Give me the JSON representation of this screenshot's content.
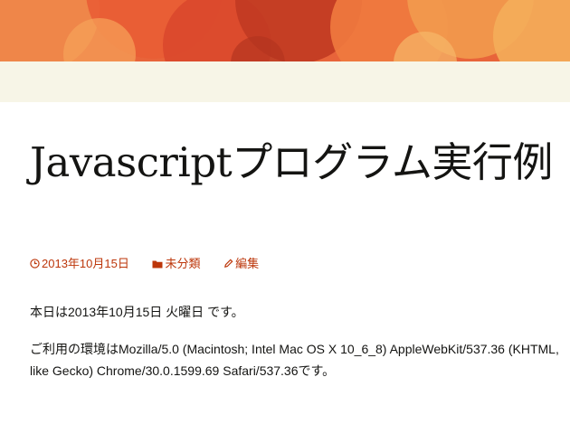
{
  "colors": {
    "banner_base": "#e8643a",
    "nav_background": "#f7f5e7",
    "link_accent": "#bc360a",
    "text": "#141412"
  },
  "post": {
    "title": "Javascriptプログラム実行例",
    "meta": {
      "date": "2013年10月15日",
      "date_icon": "clock-icon",
      "category": "未分類",
      "category_icon": "folder-icon",
      "edit": "編集",
      "edit_icon": "pencil-icon"
    },
    "content": {
      "paragraph_1": "本日は2013年10月15日 火曜日 です。",
      "paragraph_2": "ご利用の環境はMozilla/5.0 (Macintosh; Intel Mac OS X 10_6_8) AppleWebKit/537.36 (KHTML, like Gecko) Chrome/30.0.1599.69 Safari/537.36です。"
    }
  }
}
